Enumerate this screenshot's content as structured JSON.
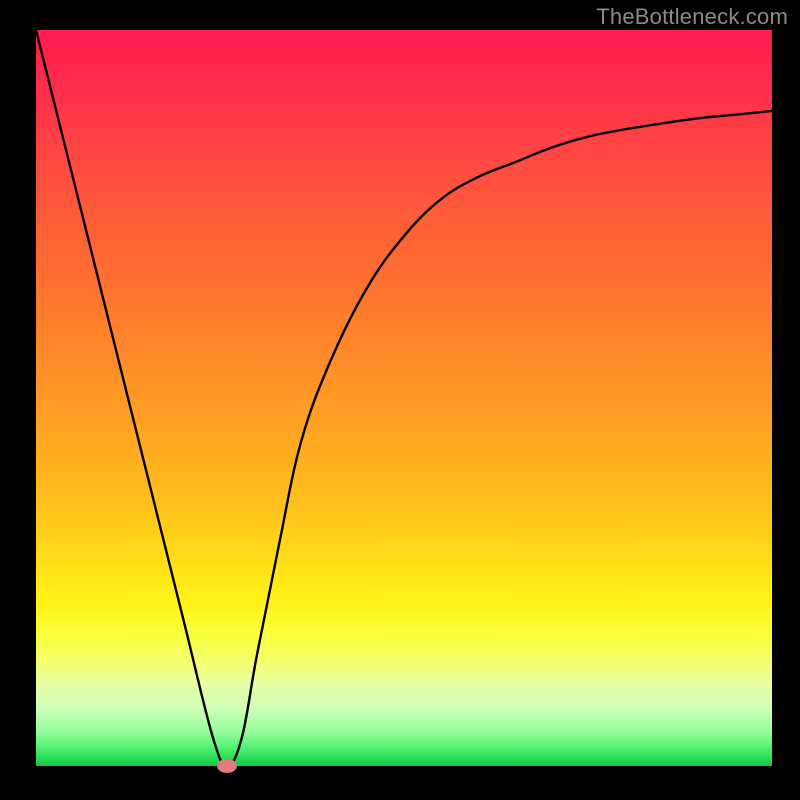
{
  "watermark": "TheBottleneck.com",
  "colors": {
    "frame": "#000000",
    "curve": "#000000",
    "marker": "#e17a7a",
    "watermark_text": "#8a8a8a"
  },
  "chart_data": {
    "type": "line",
    "title": "",
    "xlabel": "",
    "ylabel": "",
    "xlim": [
      0,
      100
    ],
    "ylim": [
      0,
      100
    ],
    "grid": false,
    "legend": false,
    "series": [
      {
        "name": "bottleneck-curve",
        "x": [
          0,
          5,
          10,
          15,
          20,
          24,
          26,
          28,
          30,
          33,
          36,
          40,
          45,
          50,
          55,
          60,
          65,
          70,
          75,
          80,
          85,
          90,
          95,
          100
        ],
        "y": [
          100,
          80,
          60,
          40,
          20,
          4,
          0,
          4,
          15,
          30,
          44,
          55,
          65,
          72,
          77,
          80,
          82,
          84,
          85.5,
          86.5,
          87.3,
          88,
          88.5,
          89
        ],
        "note": "V-shaped bottleneck curve; minimum near x≈26, rises asymptotically toward ~89 on the right."
      }
    ],
    "marker": {
      "x": 26,
      "y": 0,
      "shape": "ellipse"
    }
  }
}
